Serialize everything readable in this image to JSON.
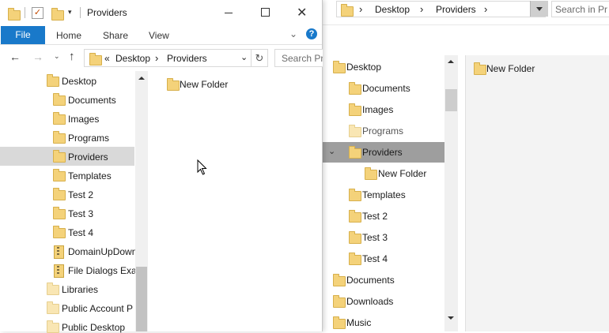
{
  "background_window": {
    "breadcrumb": [
      "Desktop",
      "Providers"
    ],
    "search_placeholder": "Search in Pr",
    "nav_items": [
      {
        "label": "Desktop",
        "level": 0
      },
      {
        "label": "Documents",
        "level": 1
      },
      {
        "label": "Images",
        "level": 1
      },
      {
        "label": "Programs",
        "level": 1
      },
      {
        "label": "Providers",
        "level": 1,
        "selected": true,
        "expanded": true
      },
      {
        "label": "New Folder",
        "level": 2
      },
      {
        "label": "Templates",
        "level": 1
      },
      {
        "label": "Test 2",
        "level": 1
      },
      {
        "label": "Test 3",
        "level": 1
      },
      {
        "label": "Test 4",
        "level": 1
      },
      {
        "label": "Documents",
        "level": 0
      },
      {
        "label": "Downloads",
        "level": 0
      },
      {
        "label": "Music",
        "level": 0
      }
    ],
    "content_items": [
      "New Folder"
    ]
  },
  "dialog": {
    "title": "Providers",
    "ribbon_tabs": {
      "file": "File",
      "home": "Home",
      "share": "Share",
      "view": "View"
    },
    "help_icon": "?",
    "address": {
      "overflow": "«",
      "crumbs": [
        "Desktop",
        "Providers"
      ]
    },
    "search_placeholder": "Search Pr",
    "nav_items": [
      {
        "label": "Desktop",
        "level": 0
      },
      {
        "label": "Documents",
        "level": 1
      },
      {
        "label": "Images",
        "level": 1
      },
      {
        "label": "Programs",
        "level": 1
      },
      {
        "label": "Providers",
        "level": 1,
        "selected": true
      },
      {
        "label": "Templates",
        "level": 1
      },
      {
        "label": "Test 2",
        "level": 1
      },
      {
        "label": "Test 3",
        "level": 1
      },
      {
        "label": "Test 4",
        "level": 1
      },
      {
        "label": "DomainUpDown",
        "level": 1,
        "icon": "zip"
      },
      {
        "label": "File Dialogs Exam",
        "level": 1,
        "icon": "zip"
      },
      {
        "label": "Libraries",
        "level": 0
      },
      {
        "label": "Public Account P",
        "level": 0
      },
      {
        "label": "Public Desktop",
        "level": 0
      }
    ],
    "content_items": [
      "New Folder"
    ]
  },
  "icons": [
    "folder-icon",
    "zip-folder-icon",
    "back-arrow-icon",
    "forward-arrow-icon",
    "up-arrow-icon",
    "refresh-icon",
    "minimize-icon",
    "maximize-icon",
    "close-icon",
    "help-icon",
    "mouse-cursor-icon"
  ],
  "colors": {
    "accent": "#1979ca",
    "selection": "#d9d9d9",
    "bg_selection": "#9e9e9e"
  }
}
